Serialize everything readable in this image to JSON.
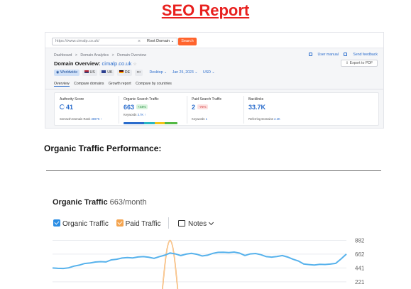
{
  "report": {
    "title": "SEO Report"
  },
  "screenshot": {
    "search": {
      "url_value": "https://www.cimalp.co.uk/",
      "clear": "×",
      "root_select": "Root Domain ⌄",
      "search_button": "Search"
    },
    "breadcrumb": [
      "Dashboard",
      ">",
      "Domain Analytics",
      ">",
      "Domain Overview"
    ],
    "user_manual": "User manual",
    "send_feedback": "Send feedback",
    "domain_overview_label": "Domain Overview:",
    "domain": "cimalp.co.uk",
    "export_pdf": "Export to PDF",
    "filters": {
      "worldwide": "Worldwide",
      "country_us": "US",
      "country_uk": "UK",
      "country_de": "DE",
      "more": "•••",
      "device": "Desktop ⌄",
      "date": "Jan 25, 2023 ⌄",
      "currency": "USD ⌄"
    },
    "tabs": [
      "Overview",
      "Compare domains",
      "Growth report",
      "Compare by countries"
    ],
    "metrics": {
      "authority": {
        "label": "Authority Score",
        "value": "41",
        "sub_label": "Semrush Domain Rank",
        "sub_value": "3697K ↑"
      },
      "organic": {
        "label": "Organic Search Traffic",
        "value": "663",
        "badge": "+44%",
        "sub_label": "Keywords",
        "sub_value": "3.7K ↑"
      },
      "paid": {
        "label": "Paid Search Traffic",
        "value": "2",
        "badge": "-75%",
        "sub_label": "Keywords",
        "sub_value": "1"
      },
      "backlinks": {
        "label": "Backlinks",
        "value": "33.7K",
        "sub_label": "Referring Domains",
        "sub_value": "2.2K"
      }
    },
    "colors": {
      "accent_blue": "#2a6ccc",
      "search_orange": "#ff642d"
    }
  },
  "section": {
    "heading": "Organic Traffic Performance:"
  },
  "organic_widget": {
    "title": "Organic Traffic",
    "per_month": "663/month",
    "legend": {
      "organic": "Organic Traffic",
      "paid": "Paid Traffic",
      "notes": "Notes"
    }
  },
  "chart_data": {
    "type": "line",
    "ylim": [
      0,
      882
    ],
    "yticks": [
      "882",
      "662",
      "441",
      "221"
    ],
    "series": [
      {
        "name": "Organic Traffic",
        "color": "#57b2ec",
        "values": [
          441,
          436,
          433,
          443,
          471,
          486,
          512,
          520,
          536,
          542,
          537,
          570,
          580,
          600,
          607,
          602,
          617,
          622,
          612,
          595,
          623,
          645,
          680,
          665,
          640,
          662,
          675,
          660,
          633,
          645,
          675,
          690,
          692,
          686,
          695,
          678,
          641,
          665,
          672,
          653,
          622,
          615,
          625,
          640,
          616,
          580,
          553,
          505,
          495,
          488,
          500,
          497,
          503,
          515,
          586,
          663
        ]
      },
      {
        "name": "Paid Traffic",
        "color": "#f4a44f",
        "values": [
          0,
          0,
          0,
          0,
          0,
          0,
          0,
          0,
          0,
          0,
          0,
          0,
          0,
          0,
          0,
          0,
          0,
          0,
          0,
          0,
          0,
          0,
          0,
          0,
          0,
          0,
          0,
          0,
          0,
          0,
          0,
          0,
          0,
          0,
          0,
          0,
          0,
          0,
          0,
          0,
          0,
          0,
          0,
          0,
          0,
          0,
          0,
          0,
          0,
          0,
          0,
          0,
          0,
          0,
          0,
          0
        ],
        "peak": {
          "index": 22,
          "value": 882
        }
      }
    ]
  }
}
